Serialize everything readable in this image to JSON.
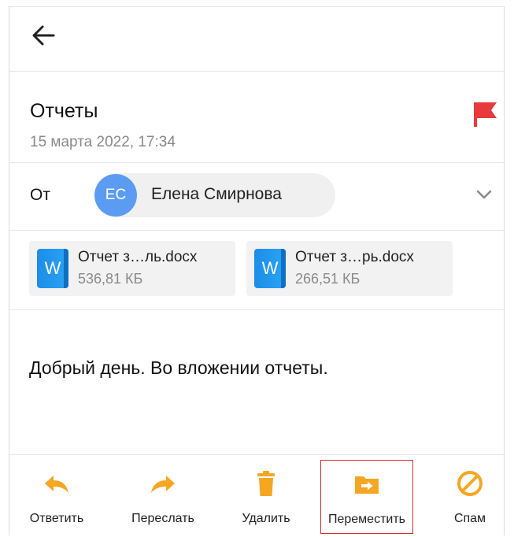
{
  "message": {
    "subject": "Отчеты",
    "date": "15 марта 2022, 17:34",
    "from_label": "От",
    "sender": {
      "initials": "ЕС",
      "name": "Елена Смирнова"
    },
    "attachments": [
      {
        "icon_letter": "W",
        "name": "Отчет з…ль.docx",
        "size": "536,81 КБ"
      },
      {
        "icon_letter": "W",
        "name": "Отчет з…рь.docx",
        "size": "266,51 КБ"
      }
    ],
    "body": "Добрый день. Во вложении отчеты."
  },
  "toolbar": {
    "reply": "Ответить",
    "forward": "Переслать",
    "delete": "Удалить",
    "move": "Переместить",
    "spam": "Спам"
  },
  "colors": {
    "accent_orange": "#f5a623",
    "flag_red": "#e8393d",
    "avatar_blue": "#5b9cf2",
    "highlight_red": "#d22f2f"
  },
  "icons": [
    "back-arrow-icon",
    "flag-icon",
    "chevron-down-icon",
    "word-doc-icon",
    "reply-icon",
    "forward-icon",
    "trash-icon",
    "move-folder-icon",
    "spam-icon"
  ]
}
